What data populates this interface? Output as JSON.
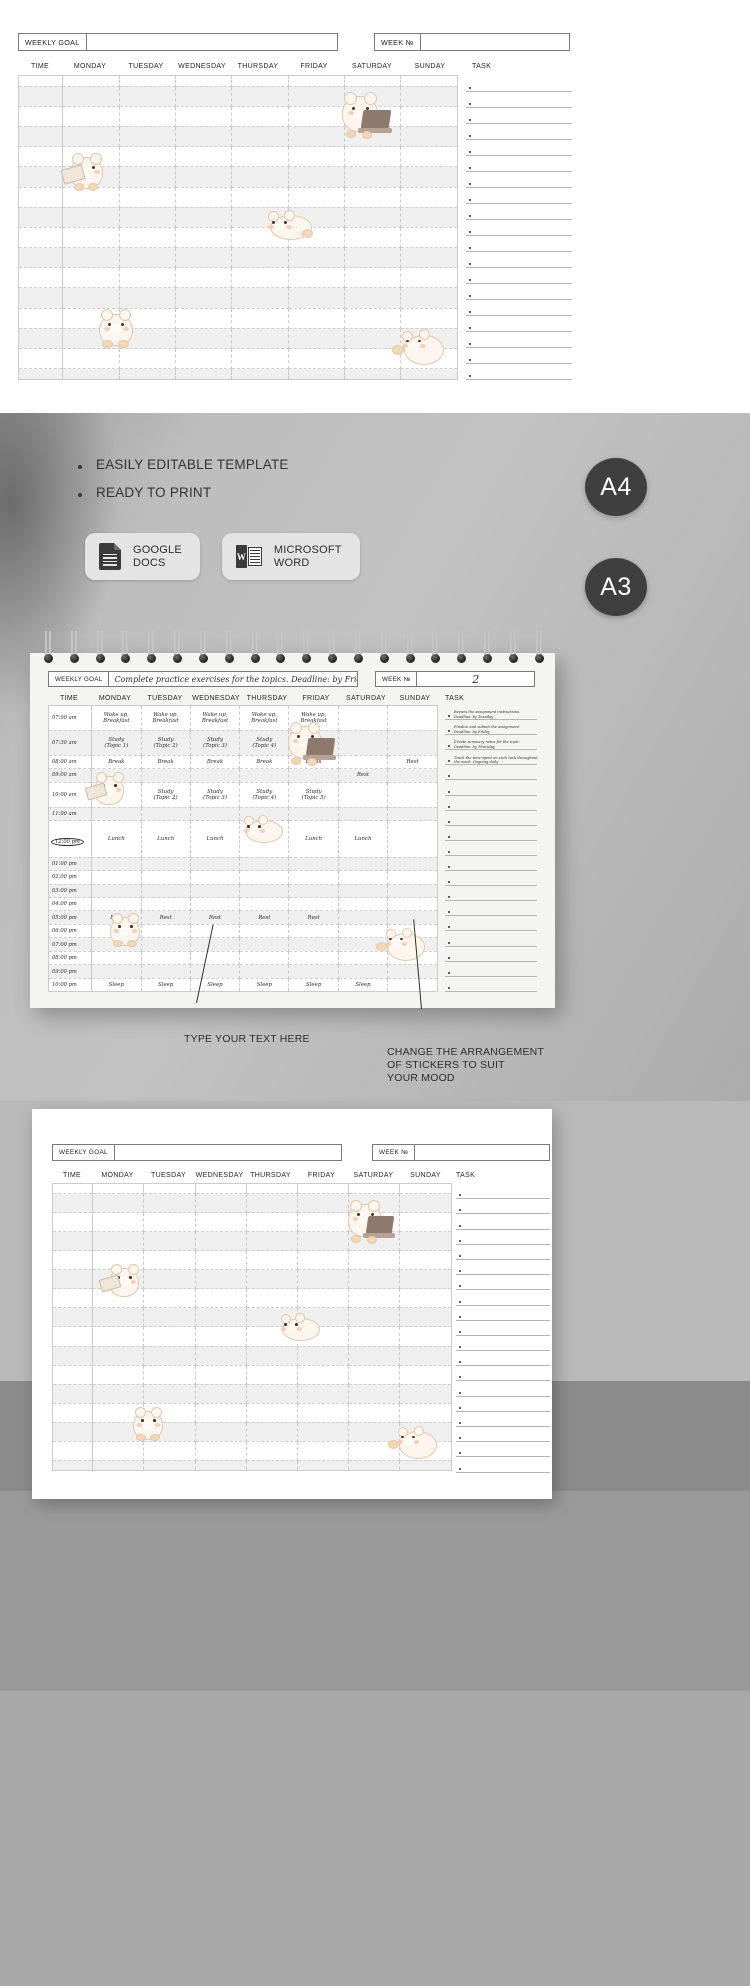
{
  "template": {
    "goal_label": "WEEKLY GOAL",
    "goal_value": "",
    "week_label": "WEEK №",
    "week_value": "",
    "columns": [
      "TIME",
      "MONDAY",
      "TUESDAY",
      "WEDNESDAY",
      "THURSDAY",
      "FRIDAY",
      "SATURDAY",
      "SUNDAY"
    ],
    "task_title": "TASK",
    "task_rows": 19,
    "time_rows": 16
  },
  "filled": {
    "goal_label": "WEEKLY GOAL",
    "goal_value": "Complete practice exercises for the topics. Deadline: by Friday.",
    "week_label": "WEEK №",
    "week_value": "2",
    "columns": [
      "TIME",
      "MONDAY",
      "TUESDAY",
      "WEDNESDAY",
      "THURSDAY",
      "FRIDAY",
      "SATURDAY",
      "SUNDAY"
    ],
    "task_title": "TASK",
    "times": [
      "07:00 am",
      "07:30 am",
      "08:00 am",
      "09:00 am",
      "10:00 am",
      "11:00 am",
      "12:00 pm",
      "01:00 pm",
      "02:00 pm",
      "03:00 pm",
      "04:00 pm",
      "05:00 pm",
      "06:00 pm",
      "07:00 pm",
      "08:00 pm",
      "09:00 pm",
      "10:00 pm"
    ],
    "highlighted_time": "12:00 pm",
    "entries": [
      {
        "time": "07:00 am",
        "monday": "Wake up,\nBreakfast",
        "tuesday": "Wake up,\nBreakfast",
        "wednesday": "Wake up,\nBreakfast",
        "thursday": "Wake up,\nBreakfast",
        "friday": "Wake up,\nBreakfast",
        "saturday": "",
        "sunday": ""
      },
      {
        "time": "07:30 am",
        "monday": "Study\n(Topic 1)",
        "tuesday": "Study\n(Topic 2)",
        "wednesday": "Study\n(Topic 3)",
        "thursday": "Study\n(Topic 4)",
        "friday": "Study\n(Topic 5)",
        "saturday": "",
        "sunday": ""
      },
      {
        "time": "08:00 am",
        "monday": "Break",
        "tuesday": "Break",
        "wednesday": "Break",
        "thursday": "Break",
        "friday": "Break",
        "saturday": "",
        "sunday": "Rest"
      },
      {
        "time": "09:00 am",
        "monday": "",
        "tuesday": "",
        "wednesday": "",
        "thursday": "",
        "friday": "",
        "saturday": "Rest",
        "sunday": ""
      },
      {
        "time": "10:00 am",
        "monday": "",
        "tuesday": "Study\n(Topic 2)",
        "wednesday": "Study\n(Topic 3)",
        "thursday": "Study\n(Topic 4)",
        "friday": "Study\n(Topic 5)",
        "saturday": "",
        "sunday": ""
      },
      {
        "time": "12:00 pm",
        "monday": "Lunch",
        "tuesday": "Lunch",
        "wednesday": "Lunch",
        "thursday": "",
        "friday": "Lunch",
        "saturday": "Lunch",
        "sunday": ""
      },
      {
        "time": "05:00 pm",
        "monday": "Rest",
        "tuesday": "Rest",
        "wednesday": "Rest",
        "thursday": "Rest",
        "friday": "Rest",
        "saturday": "",
        "sunday": ""
      },
      {
        "time": "10:00 pm",
        "monday": "Sleep",
        "tuesday": "Sleep",
        "wednesday": "Sleep",
        "thursday": "Sleep",
        "friday": "Sleep",
        "saturday": "Sleep",
        "sunday": ""
      }
    ],
    "tasks": [
      "Review the assignment instructions. Deadline: by Tuesday",
      "Finalize and submit the assignment. Deadline: by Friday",
      "Create summary notes for the topic. Deadline: by Thursday",
      "Track the time spent on each task throughout the week. Ongoing daily"
    ],
    "task_rows": 19
  },
  "promo": {
    "features": [
      "EASILY EDITABLE TEMPLATE",
      "READY TO PRINT"
    ],
    "pills": [
      {
        "icon": "google-docs-icon",
        "line1": "GOOGLE",
        "line2": "DOCS",
        "letter": ""
      },
      {
        "icon": "microsoft-word-icon",
        "line1": "MICROSOFT",
        "line2": "WORD",
        "letter": "W"
      }
    ],
    "sizes": [
      "A4",
      "A3"
    ],
    "callouts": [
      "TYPE YOUR TEXT HERE",
      "CHANGE THE ARRANGEMENT\nOF STICKERS TO SUIT\nYOUR MOOD"
    ]
  },
  "colors": {
    "dark": "#3f3f3f",
    "grey_bg": "#bdbdbd",
    "sheet": "#ffffff",
    "grid_line": "#cccccc",
    "row_alt": "#efefef",
    "bear_body": "#fdf6ef",
    "bear_outline": "#e2c9ad",
    "bear_paw": "#f4d7b4",
    "cheek": "#f6c5b4"
  }
}
